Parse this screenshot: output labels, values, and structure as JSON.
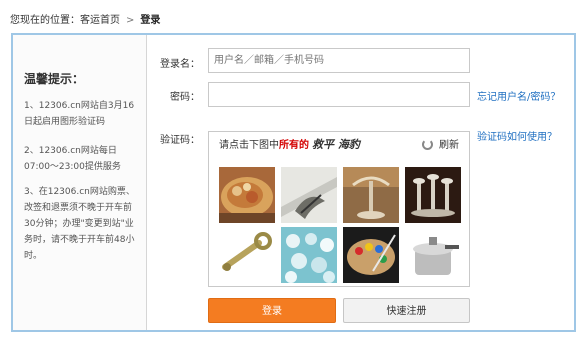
{
  "breadcrumb": {
    "prefix": "您现在的位置：",
    "home": "客运首页",
    "separator": ">",
    "current": "登录"
  },
  "tips": {
    "title": "温馨提示：",
    "items": [
      "1、12306.cn网站自3月16日起启用图形验证码",
      "2、12306.cn网站每日07:00～23:00提供服务",
      "3、在12306.cn网站购票、改签和退票须不晚于开车前30分钟；办理\"变更到站\"业务时，请不晚于开车前48小时。"
    ]
  },
  "form": {
    "username_label": "登录名：",
    "username_placeholder": "用户名／邮箱／手机号码",
    "password_label": "密码：",
    "captcha_label": "验证码：",
    "forgot_link": "忘记用户名/密码？",
    "captcha_help_link": "验证码如何使用？"
  },
  "captcha": {
    "instruction": "请点击下图中",
    "instruction_emphasis": "所有的",
    "target_word": "救平 海豹",
    "refresh_label": "刷新",
    "tiles": [
      "food",
      "ribbon",
      "lamp",
      "candlesticks",
      "wrench",
      "clothespins",
      "palette",
      "pressure-cooker"
    ]
  },
  "buttons": {
    "login": "登录",
    "quick_register": "快速注册"
  },
  "colors": {
    "accent": "#f47c21",
    "link": "#1f6fc1",
    "panel_border": "#9fc7e6",
    "emphasis": "#d40000"
  }
}
